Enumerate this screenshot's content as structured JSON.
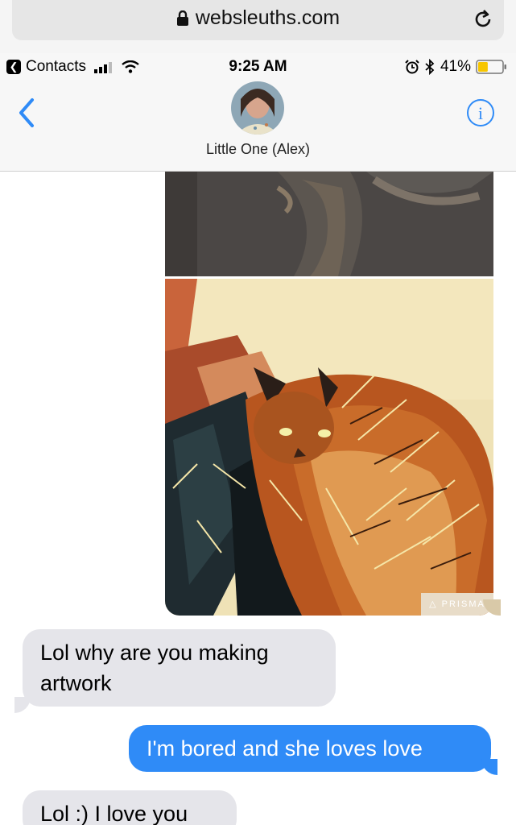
{
  "browser": {
    "url": "websleuths.com",
    "icons": {
      "lock": "lock-icon",
      "reload": "reload-icon"
    }
  },
  "status_bar": {
    "back_app": "Contacts",
    "time": "9:25 AM",
    "battery_percent": "41%",
    "battery_level": 0.41,
    "icons": [
      "signal-icon",
      "wifi-icon",
      "alarm-icon",
      "bluetooth-icon",
      "battery-icon"
    ]
  },
  "header": {
    "contact_name": "Little One (Alex)",
    "icons": {
      "back": "chevron-left-icon",
      "info": "info-icon",
      "avatar": "avatar"
    }
  },
  "messages": [
    {
      "sender": "contact",
      "text": "Lol why are you making artwork"
    },
    {
      "sender": "me",
      "text": "I'm bored and she loves love"
    },
    {
      "sender": "contact",
      "text": "Lol :) I love you"
    }
  ],
  "attachments": {
    "watermark": "PRISMA"
  },
  "colors": {
    "accent": "#2f8bf7",
    "incoming_bubble": "#e5e5ea",
    "battery_fill": "#f7c600"
  }
}
